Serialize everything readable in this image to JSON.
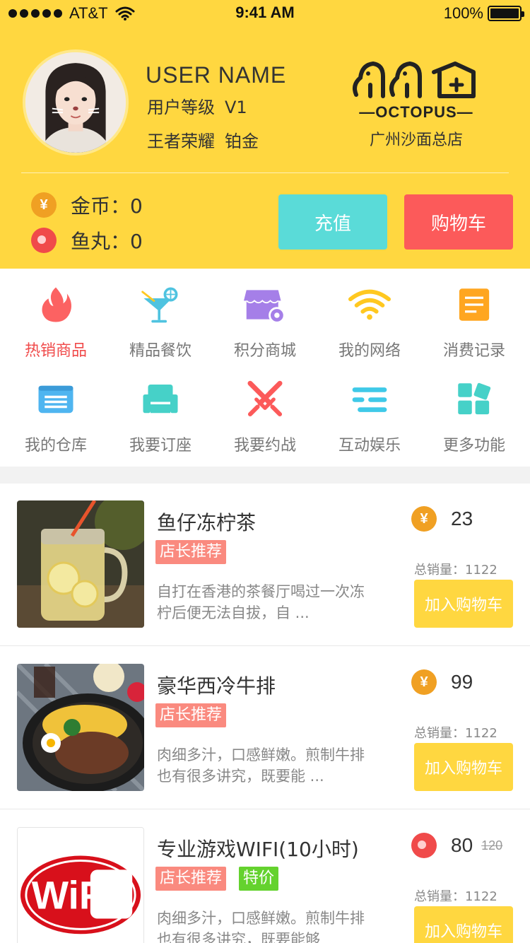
{
  "status_bar": {
    "carrier": "AT&T",
    "time": "9:41 AM",
    "battery": "100%",
    "icons": [
      "signal-dots-icon",
      "wifi-icon",
      "battery-icon"
    ]
  },
  "header": {
    "username": "USER NAME",
    "level_label": "用户等级",
    "level_value": "V1",
    "title_label": "王者荣耀",
    "title_value": "铂金",
    "logo_word": "—OCTOPUS—",
    "store_name": "广州沙面总店",
    "gold_label": "金币：0",
    "fishball_label": "鱼丸：0",
    "recharge_button": "充值",
    "cart_button": "购物车",
    "colors": {
      "background": "#FFD740",
      "recharge": "#5ADBD8",
      "cart": "#FC5A5A"
    }
  },
  "menu": {
    "items": [
      {
        "label": "热销商品",
        "icon": "flame-icon",
        "color": "#FC5A5A",
        "active": true
      },
      {
        "label": "精品餐饮",
        "icon": "cocktail-icon",
        "color": "#4FC3E0",
        "active": false
      },
      {
        "label": "积分商城",
        "icon": "store-icon",
        "color": "#A57FE8",
        "active": false
      },
      {
        "label": "我的网络",
        "icon": "wifi-icon",
        "color": "#FFC820",
        "active": false
      },
      {
        "label": "消费记录",
        "icon": "records-icon",
        "color": "#FFA620",
        "active": false
      },
      {
        "label": "我的仓库",
        "icon": "warehouse-icon",
        "color": "#4FB5F0",
        "active": false
      },
      {
        "label": "我要订座",
        "icon": "sofa-icon",
        "color": "#46D1C8",
        "active": false
      },
      {
        "label": "我要约战",
        "icon": "crossed-swords-icon",
        "color": "#FC5A5A",
        "active": false
      },
      {
        "label": "互动娱乐",
        "icon": "lines-icon",
        "color": "#3FC9E8",
        "active": false
      },
      {
        "label": "更多功能",
        "icon": "grid-icon",
        "color": "#46D1C8",
        "active": false
      }
    ]
  },
  "products": [
    {
      "name": "鱼仔冻柠茶",
      "tags": [
        "店长推荐"
      ],
      "sale_tag": "",
      "description": "自打在香港的茶餐厅喝过一次冻柠后便无法自拔，自 ...",
      "currency": "gold",
      "price": "23",
      "old_price": "",
      "sales": "总销量：1122",
      "add_button": "加入购物车",
      "image": "lemon-tea-image"
    },
    {
      "name": "豪华西冷牛排",
      "tags": [
        "店长推荐"
      ],
      "sale_tag": "",
      "description": "肉细多汁，口感鲜嫩。煎制牛排也有很多讲究，既要能 ...",
      "currency": "gold",
      "price": "99",
      "old_price": "",
      "sales": "总销量：1122",
      "add_button": "加入购物车",
      "image": "steak-image"
    },
    {
      "name": "专业游戏WIFI(10小时)",
      "tags": [
        "店长推荐"
      ],
      "sale_tag": "特价",
      "description": "肉细多汁，口感鲜嫩。煎制牛排也有很多讲究，既要能够",
      "currency": "fishball",
      "price": "80",
      "old_price": "120",
      "sales": "总销量：1122",
      "add_button": "加入购物车",
      "image": "wifi-logo-image",
      "image_text": "WiFi"
    }
  ]
}
